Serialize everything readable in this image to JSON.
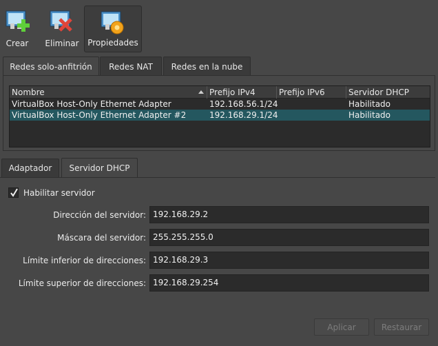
{
  "toolbar": {
    "create_label": "Crear",
    "remove_label": "Eliminar",
    "properties_label": "Propiedades"
  },
  "top_tabs": [
    "Redes solo-anfitrión",
    "Redes NAT",
    "Redes en la nube"
  ],
  "table": {
    "headers": [
      "Nombre",
      "Prefijo IPv4",
      "Prefijo IPv6",
      "Servidor DHCP"
    ],
    "rows": [
      {
        "name": "VirtualBox Host-Only Ethernet Adapter",
        "ipv4": "192.168.56.1/24",
        "ipv6": "",
        "dhcp": "Habilitado"
      },
      {
        "name": "VirtualBox Host-Only Ethernet Adapter #2",
        "ipv4": "192.168.29.1/24",
        "ipv6": "",
        "dhcp": "Habilitado"
      }
    ]
  },
  "bottom_tabs": [
    "Adaptador",
    "Servidor DHCP"
  ],
  "dhcp": {
    "enable_label": "Habilitar servidor",
    "enabled": true,
    "server_address_label": "Dirección del servidor:",
    "server_address": "192.168.29.2",
    "server_mask_label": "Máscara del servidor:",
    "server_mask": "255.255.255.0",
    "lower_bound_label": "Límite inferior de direcciones:",
    "lower_bound": "192.168.29.3",
    "upper_bound_label": "Límite superior de direcciones:",
    "upper_bound": "192.168.29.254"
  },
  "buttons": {
    "apply": "Aplicar",
    "reset": "Restaurar"
  },
  "colors": {
    "background": "#474747",
    "selection": "#24575f",
    "field": "#2b2b2b"
  }
}
